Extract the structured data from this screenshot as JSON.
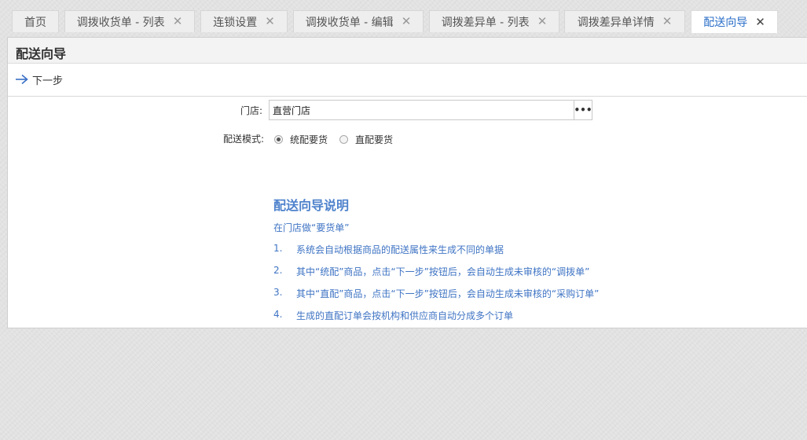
{
  "tabs": [
    {
      "label": "首页",
      "closable": false,
      "active": false
    },
    {
      "label": "调拨收货单 - 列表",
      "closable": true,
      "active": false
    },
    {
      "label": "连锁设置",
      "closable": true,
      "active": false
    },
    {
      "label": "调拨收货单 - 编辑",
      "closable": true,
      "active": false
    },
    {
      "label": "调拨差异单 - 列表",
      "closable": true,
      "active": false
    },
    {
      "label": "调拨差异单详情",
      "closable": true,
      "active": false
    },
    {
      "label": "配送向导",
      "closable": true,
      "active": true
    }
  ],
  "close_glyph": "✕",
  "panel": {
    "title": "配送向导"
  },
  "toolbar": {
    "next_label": "下一步",
    "next_icon": "arrow-right-icon"
  },
  "form": {
    "store_label": "门店:",
    "store_value": "直营门店",
    "store_picker_label": "•••",
    "mode_label": "配送模式:",
    "mode_options": [
      {
        "label": "统配要货",
        "checked": true
      },
      {
        "label": "直配要货",
        "checked": false
      }
    ]
  },
  "guide": {
    "title": "配送向导说明",
    "intro": "在门店做“要货单”",
    "items": [
      {
        "num": "1.",
        "text": "系统会自动根据商品的配送属性来生成不同的单据"
      },
      {
        "num": "2.",
        "text": "其中“统配”商品，点击“下一步”按钮后，会自动生成未审核的“调拨单”"
      },
      {
        "num": "3.",
        "text": "其中“直配”商品，点击“下一步”按钮后，会自动生成未审核的“采购订单”"
      },
      {
        "num": "4.",
        "text": "生成的直配订单会按机构和供应商自动分成多个订单"
      }
    ]
  },
  "colors": {
    "accent": "#2b6fc8",
    "guide_text": "#3f74c4",
    "arrow": "#3a6fc6"
  }
}
